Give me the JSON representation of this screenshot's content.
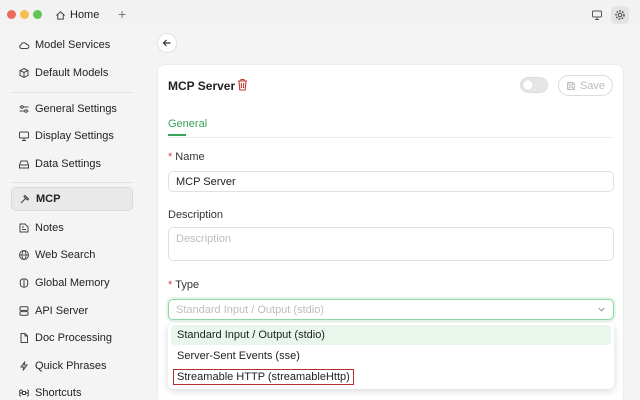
{
  "titlebar": {
    "home_tab": "Home"
  },
  "sidebar": {
    "items": [
      {
        "label": "Model Services"
      },
      {
        "label": "Default Models"
      },
      {
        "label": "General Settings"
      },
      {
        "label": "Display Settings"
      },
      {
        "label": "Data Settings"
      },
      {
        "label": "MCP"
      },
      {
        "label": "Notes"
      },
      {
        "label": "Web Search"
      },
      {
        "label": "Global Memory"
      },
      {
        "label": "API Server"
      },
      {
        "label": "Doc Processing"
      },
      {
        "label": "Quick Phrases"
      },
      {
        "label": "Shortcuts"
      }
    ],
    "active": "MCP"
  },
  "server": {
    "title": "MCP Server",
    "save_label": "Save",
    "enabled": false,
    "tab_general": "General",
    "name_label": "Name",
    "name_value": "MCP Server",
    "description_label": "Description",
    "description_placeholder": "Description",
    "type_label": "Type",
    "type_value": "Standard Input / Output (stdio)",
    "type_options": [
      "Standard Input / Output (stdio)",
      "Server-Sent Events (sse)",
      "Streamable HTTP (streamableHttp)"
    ]
  },
  "colors": {
    "accent": "#3aa05a",
    "delete": "#c0392b",
    "required": "#e04646"
  }
}
